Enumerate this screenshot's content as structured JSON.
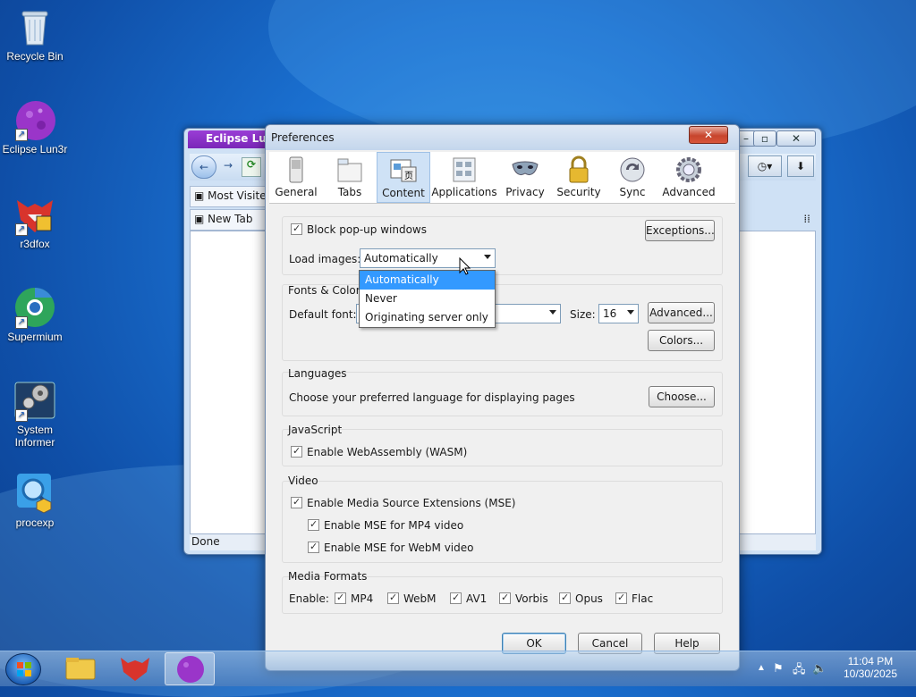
{
  "desktop": {
    "icons": [
      {
        "label": "Recycle Bin"
      },
      {
        "label": "Eclipse Lun3r"
      },
      {
        "label": "r3dfox"
      },
      {
        "label": "Supermium"
      },
      {
        "label": "System Informer"
      },
      {
        "label": "procexp"
      }
    ]
  },
  "browser": {
    "title": "Eclipse Lun3r",
    "tabs": [
      "Most Visited",
      "New Tab"
    ],
    "status": "Done"
  },
  "prefs": {
    "title": "Preferences",
    "toolbar": [
      "General",
      "Tabs",
      "Content",
      "Applications",
      "Privacy",
      "Security",
      "Sync",
      "Advanced"
    ],
    "active_tab": "Content",
    "block_popups": "Block pop-up windows",
    "exceptions": "Exceptions...",
    "load_images_label": "Load images:",
    "load_images_value": "Automatically",
    "load_images_options": [
      "Automatically",
      "Never",
      "Originating server only"
    ],
    "fonts_title": "Fonts & Colors",
    "default_font_label": "Default font:",
    "size_label": "Size:",
    "size_value": "16",
    "fonts_advanced": "Advanced...",
    "colors": "Colors...",
    "languages_title": "Languages",
    "languages_text": "Choose your preferred language for displaying pages",
    "choose": "Choose...",
    "js_title": "JavaScript",
    "wasm": "Enable WebAssembly (WASM)",
    "video_title": "Video",
    "mse": "Enable Media Source Extensions (MSE)",
    "mse_mp4": "Enable MSE for MP4 video",
    "mse_webm": "Enable MSE for WebM video",
    "media_title": "Media Formats",
    "enable_label": "Enable:",
    "formats": [
      "MP4",
      "WebM",
      "AV1",
      "Vorbis",
      "Opus",
      "Flac"
    ],
    "ok": "OK",
    "cancel": "Cancel",
    "help": "Help"
  },
  "taskbar": {
    "time": "11:04 PM",
    "date": "10/30/2025"
  },
  "colors": {
    "accent": "#3399ff",
    "wallpaper": "#1a6fcf"
  }
}
